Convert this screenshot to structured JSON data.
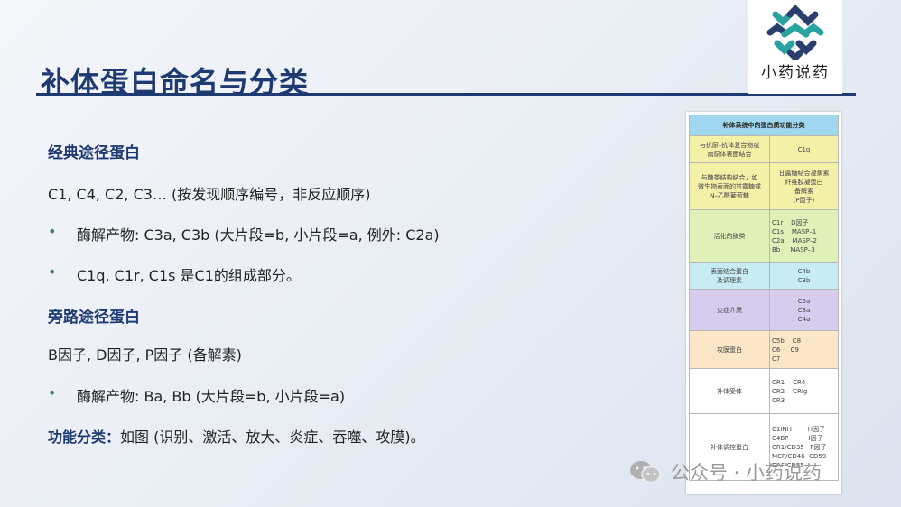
{
  "slide": {
    "title": "补体蛋白命名与分类"
  },
  "logo": {
    "text": "小药说药",
    "colors": {
      "teal": "#2aa3a0",
      "navy": "#2a3f6e"
    }
  },
  "content": {
    "classical_heading": "经典途径蛋白",
    "classical_line": "C1, C4, C2, C3… (按发现顺序编号，非反应顺序)",
    "classical_bullets": [
      "酶解产物: C3a, C3b (大片段=b, 小片段=a, 例外: C2a)",
      "C1q, C1r, C1s 是C1的组成部分。"
    ],
    "alternative_heading": "旁路途径蛋白",
    "alternative_line": "B因子, D因子, P因子 (备解素)",
    "alternative_bullets": [
      "酶解产物: Ba, Bb (大片段=b, 小片段=a)"
    ],
    "function_label": "功能分类：",
    "function_text": "如图 (识别、激活、放大、炎症、吞噬、攻膜)。",
    "bullet_symbol": "•"
  },
  "table": {
    "header": "补体系统中的蛋白质功能分类",
    "rows": [
      {
        "func": "与抗原–抗体复合物或\n病原体表面结合",
        "proteins": "C1q",
        "color": "#f3f0a8"
      },
      {
        "func": "与糖类结构结合，如\n微生物表面的甘露糖或\nN–乙酰葡萄糖",
        "proteins": "甘露糖结合凝集素\n纤维胶凝蛋白\n备解素\n（P因子）",
        "color": "#f3f0a8"
      },
      {
        "func": "活化的酶类",
        "proteins": "C1r    D因子\nC1s    MASP–1\nC2a    MASP–2\nBb     MASP–3",
        "color": "#dff0b8"
      },
      {
        "func": "表面结合蛋白\n及调理素",
        "proteins": "C4b\nC3b",
        "color": "#c7ecf4"
      },
      {
        "func": "炎症介质",
        "proteins": "C5a\nC3a\nC4a",
        "color": "#d6cdee"
      },
      {
        "func": "攻膜蛋白",
        "proteins": "C5b    C8\nC6     C9\nC7",
        "color": "#fbe7c8"
      },
      {
        "func": "补体受体",
        "proteins": "CR1    CR4\nCR2    CRIg\nCR3",
        "color": "#ffffff"
      },
      {
        "func": "补体调控蛋白",
        "proteins": "C1INH        H因子\nC4BP          I因子\nCR1/CD35   P因子\nMCP/CD46  CD59\nDAF/CD55",
        "color": "#ffffff"
      }
    ],
    "header_color": "#9fd8ee"
  },
  "watermark": {
    "text": "公众号 · 小药说药"
  }
}
